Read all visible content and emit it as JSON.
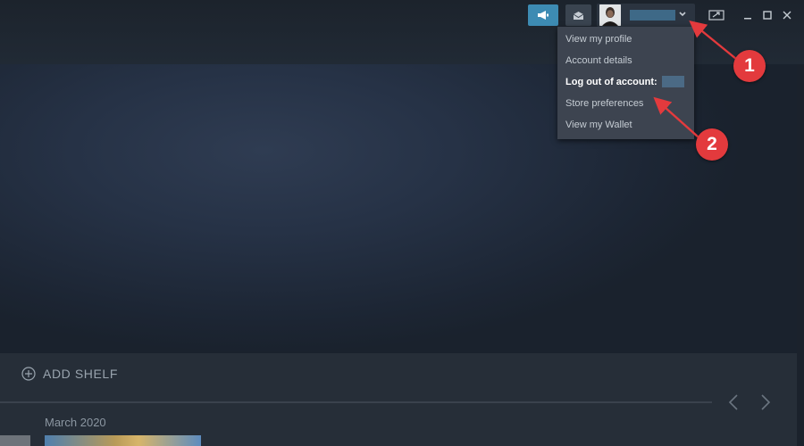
{
  "header": {
    "announcement_icon": "megaphone-icon",
    "notification_icon": "envelope-icon",
    "user_caret_icon": "chevron-down-icon",
    "window_controls": [
      "restore-screen-icon",
      "minimize-icon",
      "maximize-icon",
      "close-icon"
    ]
  },
  "account_menu": {
    "items": [
      {
        "label": "View my profile"
      },
      {
        "label": "Account details"
      },
      {
        "label": "Log out of account:"
      },
      {
        "label": "Store preferences"
      },
      {
        "label": "View my Wallet"
      }
    ]
  },
  "shelf": {
    "add_label": "ADD SHELF",
    "section_date": "March 2020"
  },
  "annotations": {
    "callout_1": "1",
    "callout_2": "2"
  },
  "colors": {
    "accent": "#3d8bb3",
    "annotation_red": "#e33a3d",
    "menu_bg": "#3d4450"
  }
}
